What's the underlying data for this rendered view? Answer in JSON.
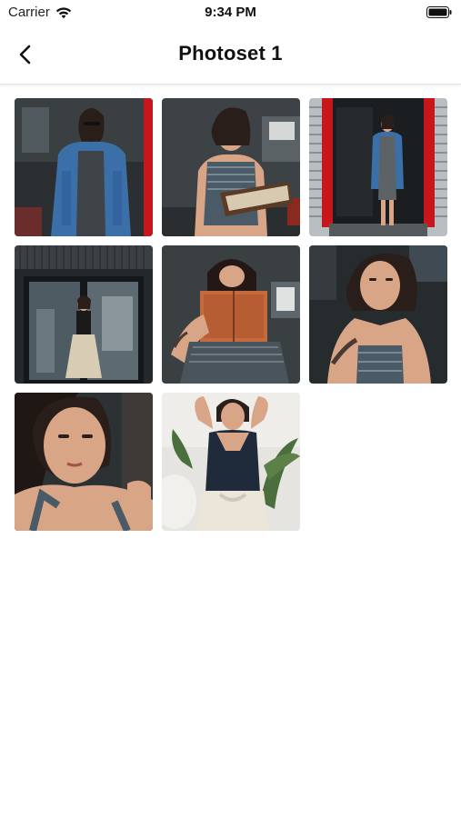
{
  "status_bar": {
    "carrier": "Carrier",
    "time": "9:34 PM",
    "wifi_icon": "wifi-icon",
    "battery_icon": "battery-icon"
  },
  "nav": {
    "title": "Photoset 1",
    "back_icon": "chevron-left-icon"
  },
  "photos": [
    {
      "id": "photo-1",
      "subject": "woman in denim jacket standing"
    },
    {
      "id": "photo-2",
      "subject": "woman reading book behind glass"
    },
    {
      "id": "photo-3",
      "subject": "woman standing in red doorway"
    },
    {
      "id": "photo-4",
      "subject": "woman in front of dark building"
    },
    {
      "id": "photo-5",
      "subject": "woman holding orange book"
    },
    {
      "id": "photo-6",
      "subject": "woman resting chin on hands"
    },
    {
      "id": "photo-7",
      "subject": "close-up portrait"
    },
    {
      "id": "photo-8",
      "subject": "woman with arms raised in white room"
    }
  ],
  "colors": {
    "accent_red": "#c8161d",
    "denim": "#3b6fa8",
    "skin": "#d9a587",
    "dark_bg": "#1f2426"
  }
}
